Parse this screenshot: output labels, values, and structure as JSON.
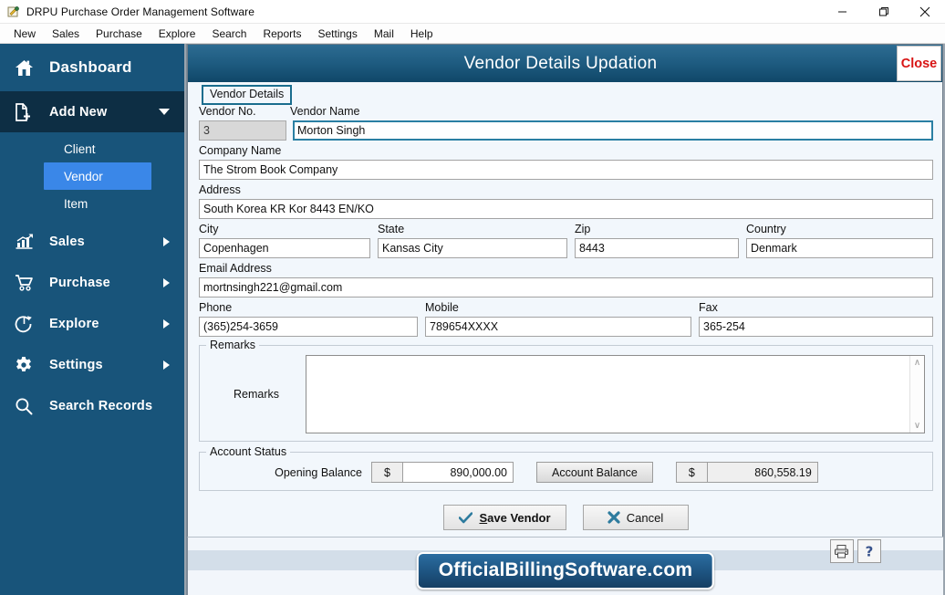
{
  "window": {
    "title": "DRPU Purchase Order Management Software",
    "app_icon": "app-logo-icon",
    "minimize_label": "—",
    "maximize_label": "❐",
    "close_label": "✕"
  },
  "menubar": {
    "items": [
      {
        "label": "New"
      },
      {
        "label": "Sales"
      },
      {
        "label": "Purchase"
      },
      {
        "label": "Explore"
      },
      {
        "label": "Search"
      },
      {
        "label": "Reports"
      },
      {
        "label": "Settings"
      },
      {
        "label": "Mail"
      },
      {
        "label": "Help"
      }
    ]
  },
  "sidebar": {
    "dashboard": {
      "label": "Dashboard",
      "icon": "home-icon"
    },
    "add_new": {
      "label": "Add New",
      "icon": "document-add-icon",
      "caret": "chevron-down-icon"
    },
    "add_new_children": [
      {
        "label": "Client"
      },
      {
        "label": "Vendor"
      },
      {
        "label": "Item"
      }
    ],
    "selected_child": "Vendor",
    "items": [
      {
        "label": "Sales",
        "icon": "chart-bar-icon",
        "caret": "chevron-right-icon"
      },
      {
        "label": "Purchase",
        "icon": "shopping-cart-icon",
        "caret": "chevron-right-icon"
      },
      {
        "label": "Explore",
        "icon": "pie-chart-icon",
        "caret": "chevron-right-icon"
      },
      {
        "label": "Settings",
        "icon": "gear-icon",
        "caret": "chevron-right-icon"
      },
      {
        "label": "Search Records",
        "icon": "magnifier-icon",
        "caret": ""
      }
    ]
  },
  "panel": {
    "title": "Vendor Details Updation",
    "close_label": "Close",
    "tab_label": "Vendor Details"
  },
  "form": {
    "vendor_no": {
      "label": "Vendor No.",
      "value": "3",
      "disabled": true
    },
    "vendor_name": {
      "label": "Vendor Name",
      "value": "Morton Singh",
      "placeholder": ""
    },
    "company_name": {
      "label": "Company Name",
      "value": "The Strom Book Company",
      "placeholder": ""
    },
    "address": {
      "label": "Address",
      "value": "South Korea KR Kor 8443 EN/KO",
      "placeholder": ""
    },
    "city": {
      "label": "City",
      "value": "Copenhagen",
      "placeholder": ""
    },
    "state": {
      "label": "State",
      "value": "Kansas City",
      "placeholder": ""
    },
    "zip": {
      "label": "Zip",
      "value": "8443",
      "placeholder": ""
    },
    "country": {
      "label": "Country",
      "value": "Denmark",
      "placeholder": ""
    },
    "email": {
      "label": "Email Address",
      "value": "mortnsingh221@gmail.com",
      "placeholder": ""
    },
    "phone": {
      "label": "Phone",
      "value": "(365)254-3659",
      "placeholder": ""
    },
    "mobile": {
      "label": "Mobile",
      "value": "789654XXXX",
      "placeholder": ""
    },
    "fax": {
      "label": "Fax",
      "value": "365-254",
      "placeholder": ""
    }
  },
  "remarks": {
    "legend": "Remarks",
    "label": "Remarks",
    "value": "",
    "placeholder": "",
    "scroll_up": "∧",
    "scroll_down": "∨"
  },
  "account_status": {
    "legend": "Account Status",
    "opening_balance_label": "Opening Balance",
    "opening_balance_currency": "$",
    "opening_balance_value": "890,000.00",
    "account_balance_button": "Account Balance",
    "account_balance_currency": "$",
    "account_balance_value": "860,558.19"
  },
  "actions": {
    "save_label_prefix": "S",
    "save_label_rest": "ave Vendor",
    "save_icon": "check-icon",
    "cancel_label": "Cancel",
    "cancel_icon": "cross-icon"
  },
  "footer": {
    "brand": "OfficialBillingSoftware.com",
    "print_icon": "printer-icon",
    "help_icon": "question-mark-icon"
  },
  "colors": {
    "sidebar_bg": "#18547a",
    "sidebar_expanded": "#0d2e44",
    "sidebar_selected": "#3a87e8",
    "header_blue": "#1e5b80",
    "accent_teal": "#1a6d8e",
    "close_red": "#d81414",
    "form_bg": "#f2f7fc"
  }
}
